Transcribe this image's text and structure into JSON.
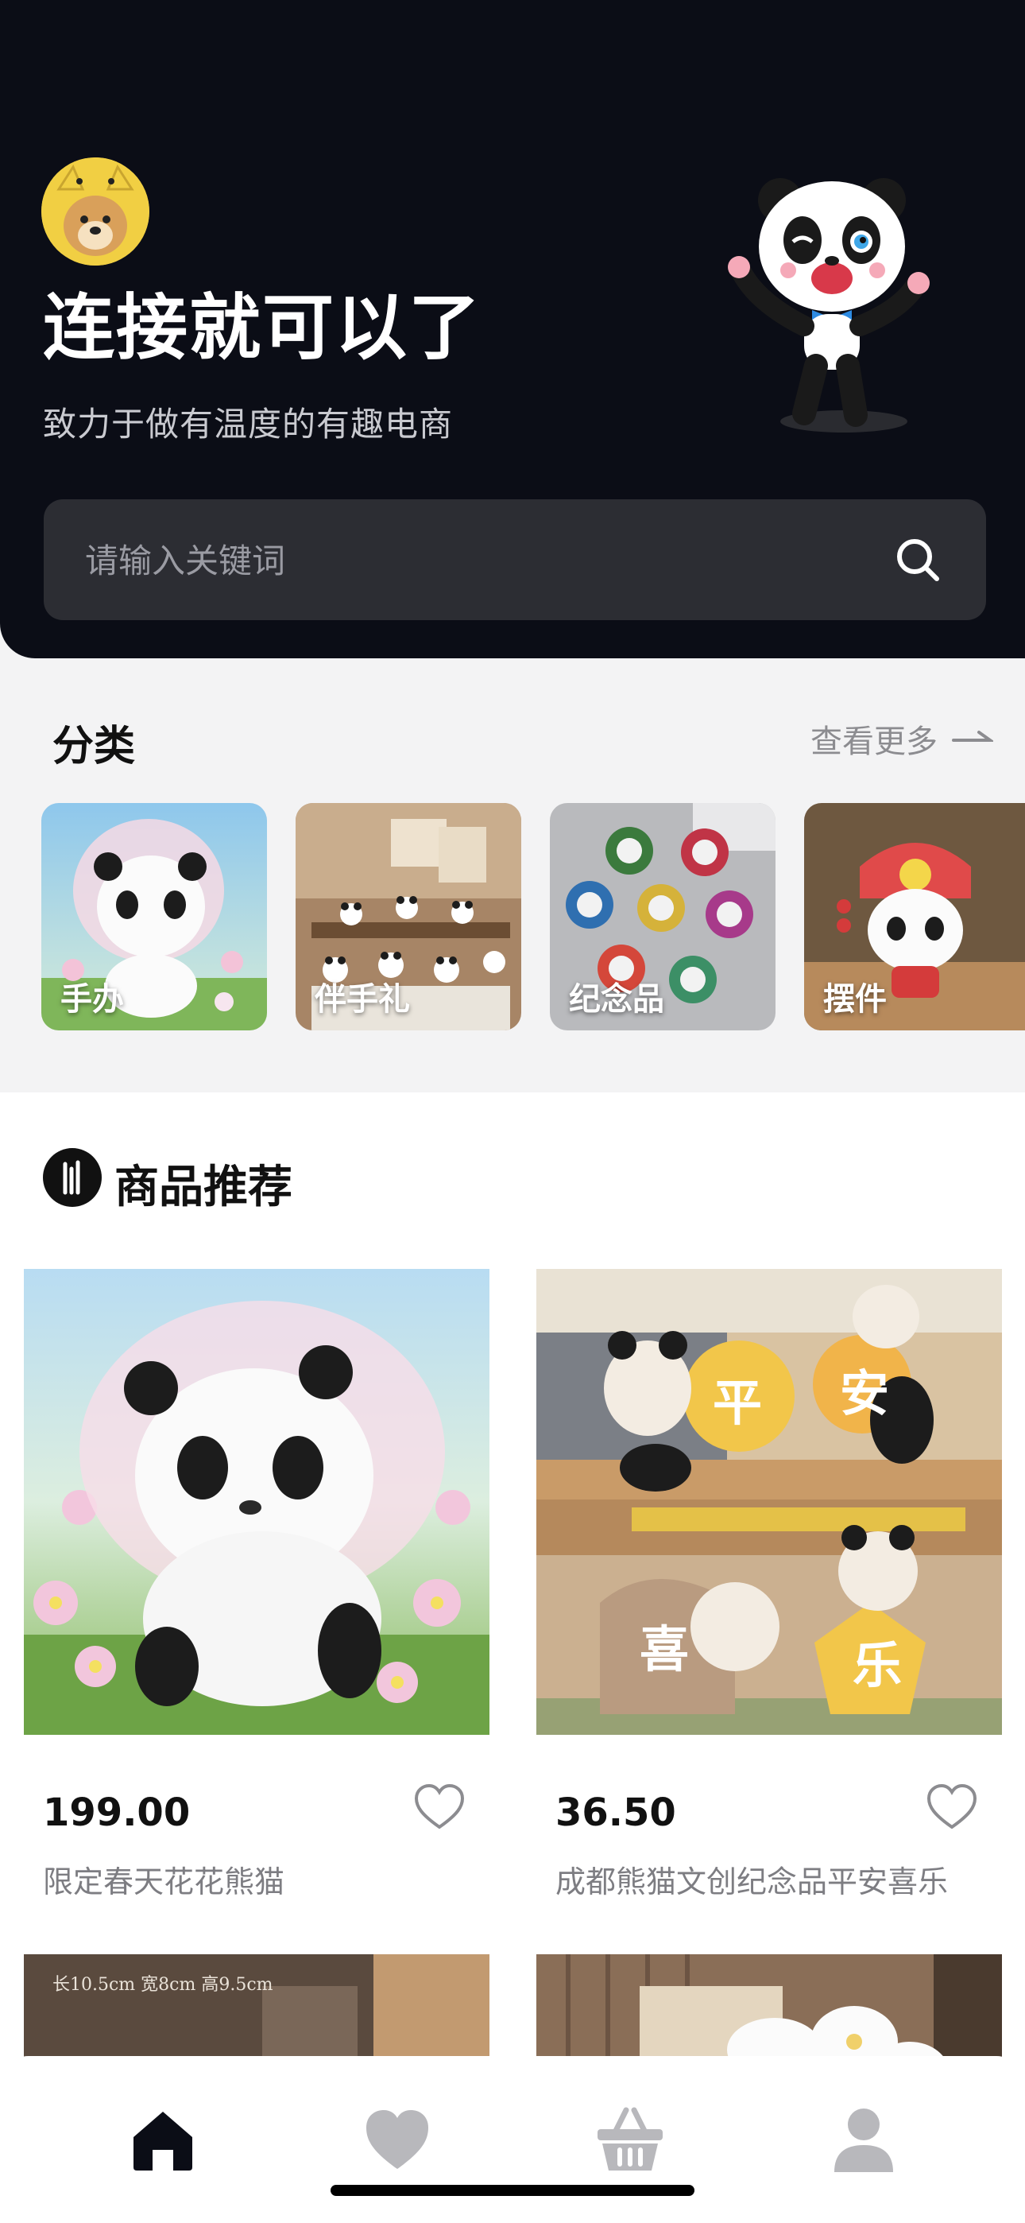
{
  "header": {
    "title": "连接就可以了",
    "subtitle": "致力于做有温度的有趣电商",
    "avatar_icon": "dog-avatar",
    "mascot_icon": "panda-mascot"
  },
  "search": {
    "placeholder": "请输入关键词",
    "value": "",
    "icon": "search-icon"
  },
  "categories": {
    "title": "分类",
    "more_label": "查看更多",
    "items": [
      {
        "label": "手办"
      },
      {
        "label": "伴手礼"
      },
      {
        "label": "纪念品"
      },
      {
        "label": "摆件"
      }
    ]
  },
  "recommend": {
    "title": "商品推荐",
    "products": [
      {
        "price": "199.00",
        "name": "限定春天花花熊猫"
      },
      {
        "price": "36.50",
        "name": "成都熊猫文创纪念品平安喜乐"
      },
      {
        "caption": "长10.5cm 宽8cm 高9.5cm"
      },
      {}
    ],
    "image_glyphs": [
      "平",
      "安",
      "喜",
      "乐"
    ]
  },
  "tabbar": {
    "items": [
      {
        "icon": "home-icon",
        "active": true
      },
      {
        "icon": "heart-icon",
        "active": false
      },
      {
        "icon": "basket-icon",
        "active": false
      },
      {
        "icon": "user-icon",
        "active": false
      }
    ],
    "active_color": "#0b0d16",
    "inactive_color": "#b8b8bc"
  }
}
